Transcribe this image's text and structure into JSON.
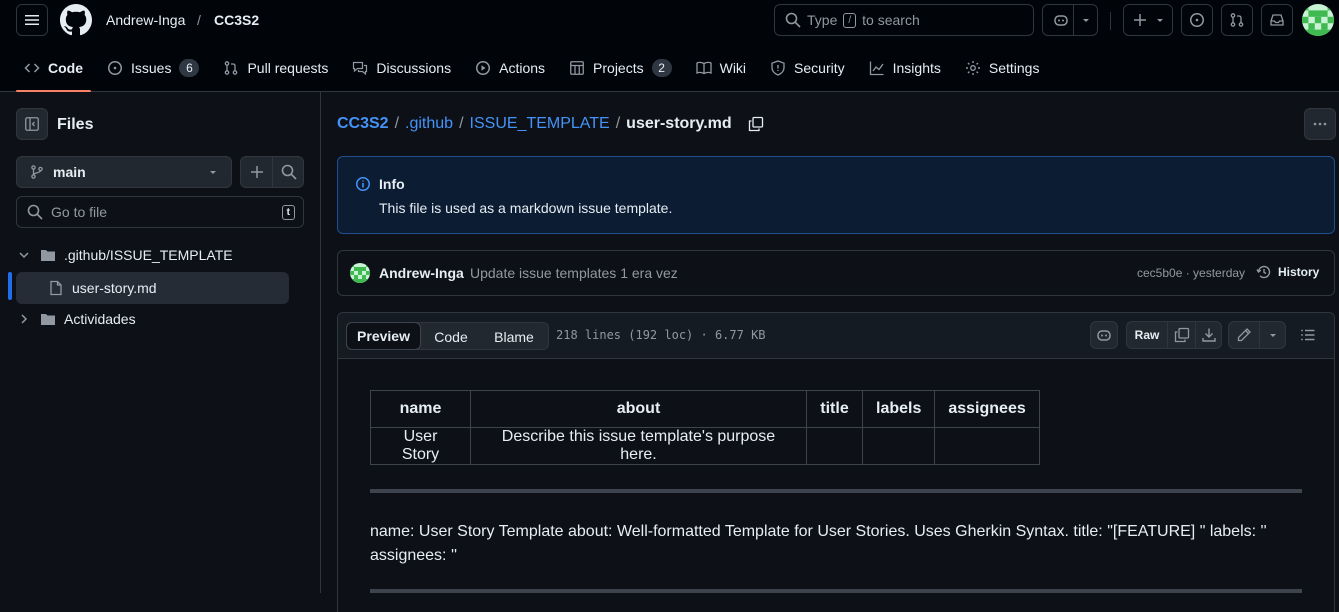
{
  "header": {
    "owner": "Andrew-Inga",
    "separator": "/",
    "repo": "CC3S2",
    "search_prefix": "Type",
    "search_key": "/",
    "search_suffix": "to search"
  },
  "repo_tabs": [
    {
      "label": "Code",
      "counter": ""
    },
    {
      "label": "Issues",
      "counter": "6"
    },
    {
      "label": "Pull requests",
      "counter": ""
    },
    {
      "label": "Discussions",
      "counter": ""
    },
    {
      "label": "Actions",
      "counter": ""
    },
    {
      "label": "Projects",
      "counter": "2"
    },
    {
      "label": "Wiki",
      "counter": ""
    },
    {
      "label": "Security",
      "counter": ""
    },
    {
      "label": "Insights",
      "counter": ""
    },
    {
      "label": "Settings",
      "counter": ""
    }
  ],
  "sidebar": {
    "title": "Files",
    "branch": "main",
    "goto_placeholder": "Go to file",
    "goto_key": "t",
    "tree": [
      {
        "label": ".github/ISSUE_TEMPLATE",
        "type": "folder-open"
      },
      {
        "label": "user-story.md",
        "type": "file"
      },
      {
        "label": "Actividades",
        "type": "folder"
      }
    ]
  },
  "breadcrumb": {
    "repo": "CC3S2",
    "sep": "/",
    "dir1": ".github",
    "dir2": "ISSUE_TEMPLATE",
    "file": "user-story.md"
  },
  "info": {
    "title": "Info",
    "text": "This file is used as a markdown issue template."
  },
  "commit": {
    "author": "Andrew-Inga",
    "message": "Update issue templates 1 era vez",
    "hash_time": "cec5b0e · yesterday",
    "history": "History"
  },
  "file_toolbar": {
    "modes": [
      "Preview",
      "Code",
      "Blame"
    ],
    "meta": "218 lines (192 loc) · 6.77 KB",
    "raw": "Raw"
  },
  "content": {
    "table": {
      "headers": [
        "name",
        "about",
        "title",
        "labels",
        "assignees"
      ],
      "row": [
        "User Story",
        "Describe this issue template's purpose here.",
        "",
        "",
        ""
      ]
    },
    "paragraph_line1": "name: User Story Template about: Well-formatted Template for User Stories. Uses Gherkin Syntax. title: \"[FEATURE] \" labels: ''",
    "paragraph_line2": "assignees: ''"
  },
  "colors": {
    "accent_underline": "#f78166",
    "link": "#4493f8",
    "info_bg": "#0c2d6b"
  }
}
